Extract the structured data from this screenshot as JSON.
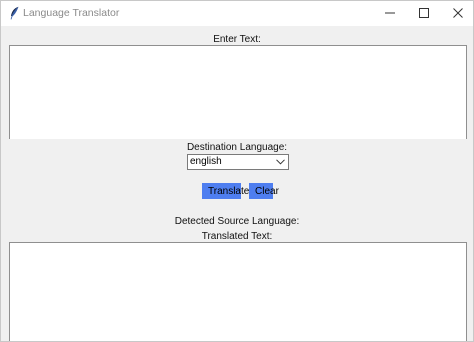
{
  "window": {
    "title": "Language Translator",
    "icon": "feather-icon"
  },
  "input": {
    "label": "Enter Text:",
    "value": ""
  },
  "destination": {
    "label": "Destination Language:",
    "selected": "english"
  },
  "buttons": {
    "translate": "Translate",
    "clear": "Clear"
  },
  "detected": {
    "label": "Detected Source Language:"
  },
  "output": {
    "label": "Translated Text:",
    "value": ""
  },
  "colors": {
    "button": "#4e7ef0",
    "background": "#f0f0f0"
  }
}
